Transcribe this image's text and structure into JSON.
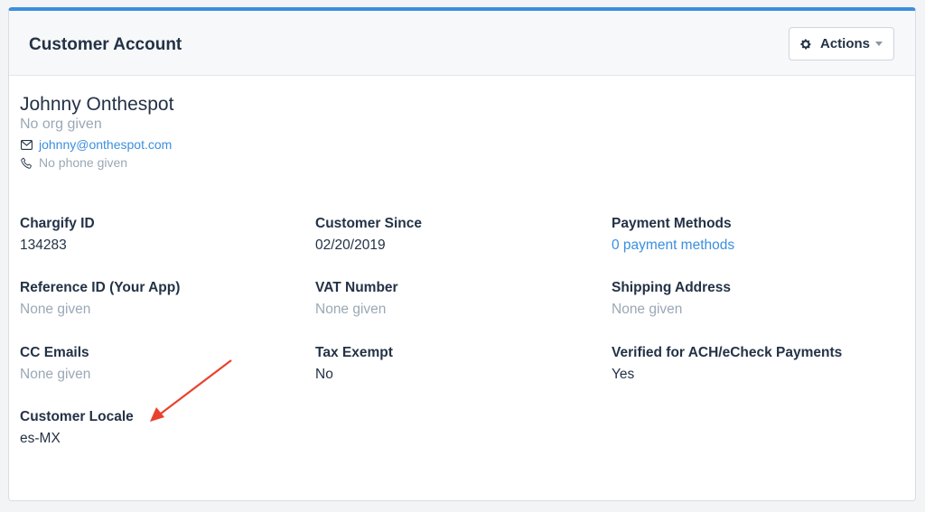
{
  "header": {
    "title": "Customer Account",
    "actions_label": "Actions",
    "actions_icon": "gear-icon"
  },
  "contact": {
    "name": "Johnny Onthespot",
    "org": "No org given",
    "email": "johnny@onthespot.com",
    "phone": "No phone given"
  },
  "fields": {
    "chargify_id": {
      "label": "Chargify ID",
      "value": "134283"
    },
    "customer_since": {
      "label": "Customer Since",
      "value": "02/20/2019"
    },
    "payment_methods": {
      "label": "Payment Methods",
      "value": "0 payment methods"
    },
    "reference_id": {
      "label": "Reference ID (Your App)",
      "value": "None given"
    },
    "vat_number": {
      "label": "VAT Number",
      "value": "None given"
    },
    "shipping_address": {
      "label": "Shipping Address",
      "value": "None given"
    },
    "cc_emails": {
      "label": "CC Emails",
      "value": "None given"
    },
    "tax_exempt": {
      "label": "Tax Exempt",
      "value": "No"
    },
    "verified_ach": {
      "label": "Verified for ACH/eCheck Payments",
      "value": "Yes"
    },
    "customer_locale": {
      "label": "Customer Locale",
      "value": "es-MX"
    }
  },
  "colors": {
    "accent": "#3b8fde",
    "text": "#233246",
    "muted": "#9aa8b6",
    "annotation_arrow": "#e8412c"
  }
}
